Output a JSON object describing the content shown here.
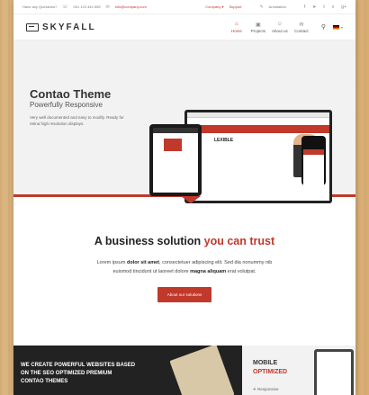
{
  "topbar": {
    "questions": "Have any Questions?",
    "phone": "001 123 444 555",
    "email": "info@company.com",
    "company": "Company",
    "support": "Support",
    "annotation": "Annotation",
    "social_icons": [
      "facebook-icon",
      "send-icon",
      "twitter-icon",
      "vimeo-icon",
      "google-plus-icon"
    ]
  },
  "header": {
    "logo": "SKYFALL",
    "nav": [
      {
        "label": "Home",
        "icon": "house-icon"
      },
      {
        "label": "Projects",
        "icon": "folder-icon"
      },
      {
        "label": "About us",
        "icon": "users-icon"
      },
      {
        "label": "Contact",
        "icon": "envelope-icon"
      }
    ],
    "search_icon": "search-icon",
    "language_flag": "flag-de-icon"
  },
  "hero": {
    "title": "Contao Theme",
    "subtitle": "Powerfully Responsive",
    "description": "Very well documented and easy to modify. Ready for retina high resolution displays.",
    "screen_headline": "LEXIBLE"
  },
  "business": {
    "title_lead": "A business solution ",
    "title_accent": "you can trust",
    "text_1": "Lorem ipsum ",
    "text_bold_1": "dolor sit amet",
    "text_2": ", consectetuer adipiscing elit. Sed dia nonummy nib euismod tincidunt ut laoreet dolore ",
    "text_bold_2": "magna aliquam",
    "text_3": " erat volutpat.",
    "cta": "About our solutions"
  },
  "bottom": {
    "left_line_1": "WE CREATE POWERFUL WEBSITES BASED",
    "left_line_2": "ON THE SEO OPTIMIZED PREMIUM",
    "left_line_3": "CONTAO THEMES",
    "right_title": "MOBILE",
    "right_accent": "OPTIMIZED",
    "right_feature": "Responsive"
  },
  "colors": {
    "accent": "#c0392b",
    "dark": "#222222",
    "background_wood": "#e7c99a"
  }
}
